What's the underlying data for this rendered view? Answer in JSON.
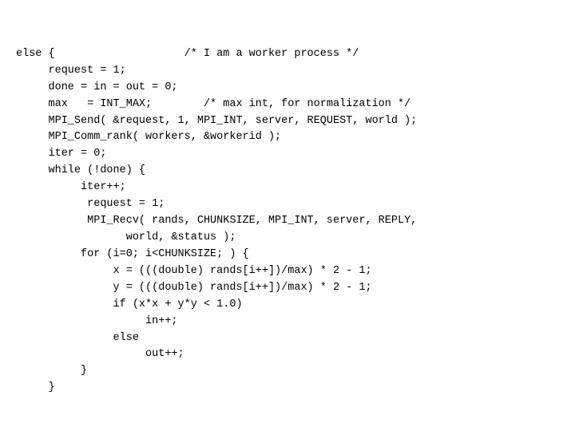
{
  "code": {
    "lines": [
      "else {                    /* I am a worker process */",
      "     request = 1;",
      "     done = in = out = 0;",
      "     max   = INT_MAX;        /* max int, for normalization */",
      "     MPI_Send( &request, 1, MPI_INT, server, REQUEST, world );",
      "     MPI_Comm_rank( workers, &workerid );",
      "     iter = 0;",
      "     while (!done) {",
      "          iter++;",
      "           request = 1;",
      "           MPI_Recv( rands, CHUNKSIZE, MPI_INT, server, REPLY,",
      "                 world, &status );",
      "          for (i=0; i<CHUNKSIZE; ) {",
      "               x = (((double) rands[i++])/max) * 2 - 1;",
      "               y = (((double) rands[i++])/max) * 2 - 1;",
      "               if (x*x + y*y < 1.0)",
      "                    in++;",
      "               else",
      "                    out++;",
      "          }",
      "     }"
    ]
  }
}
